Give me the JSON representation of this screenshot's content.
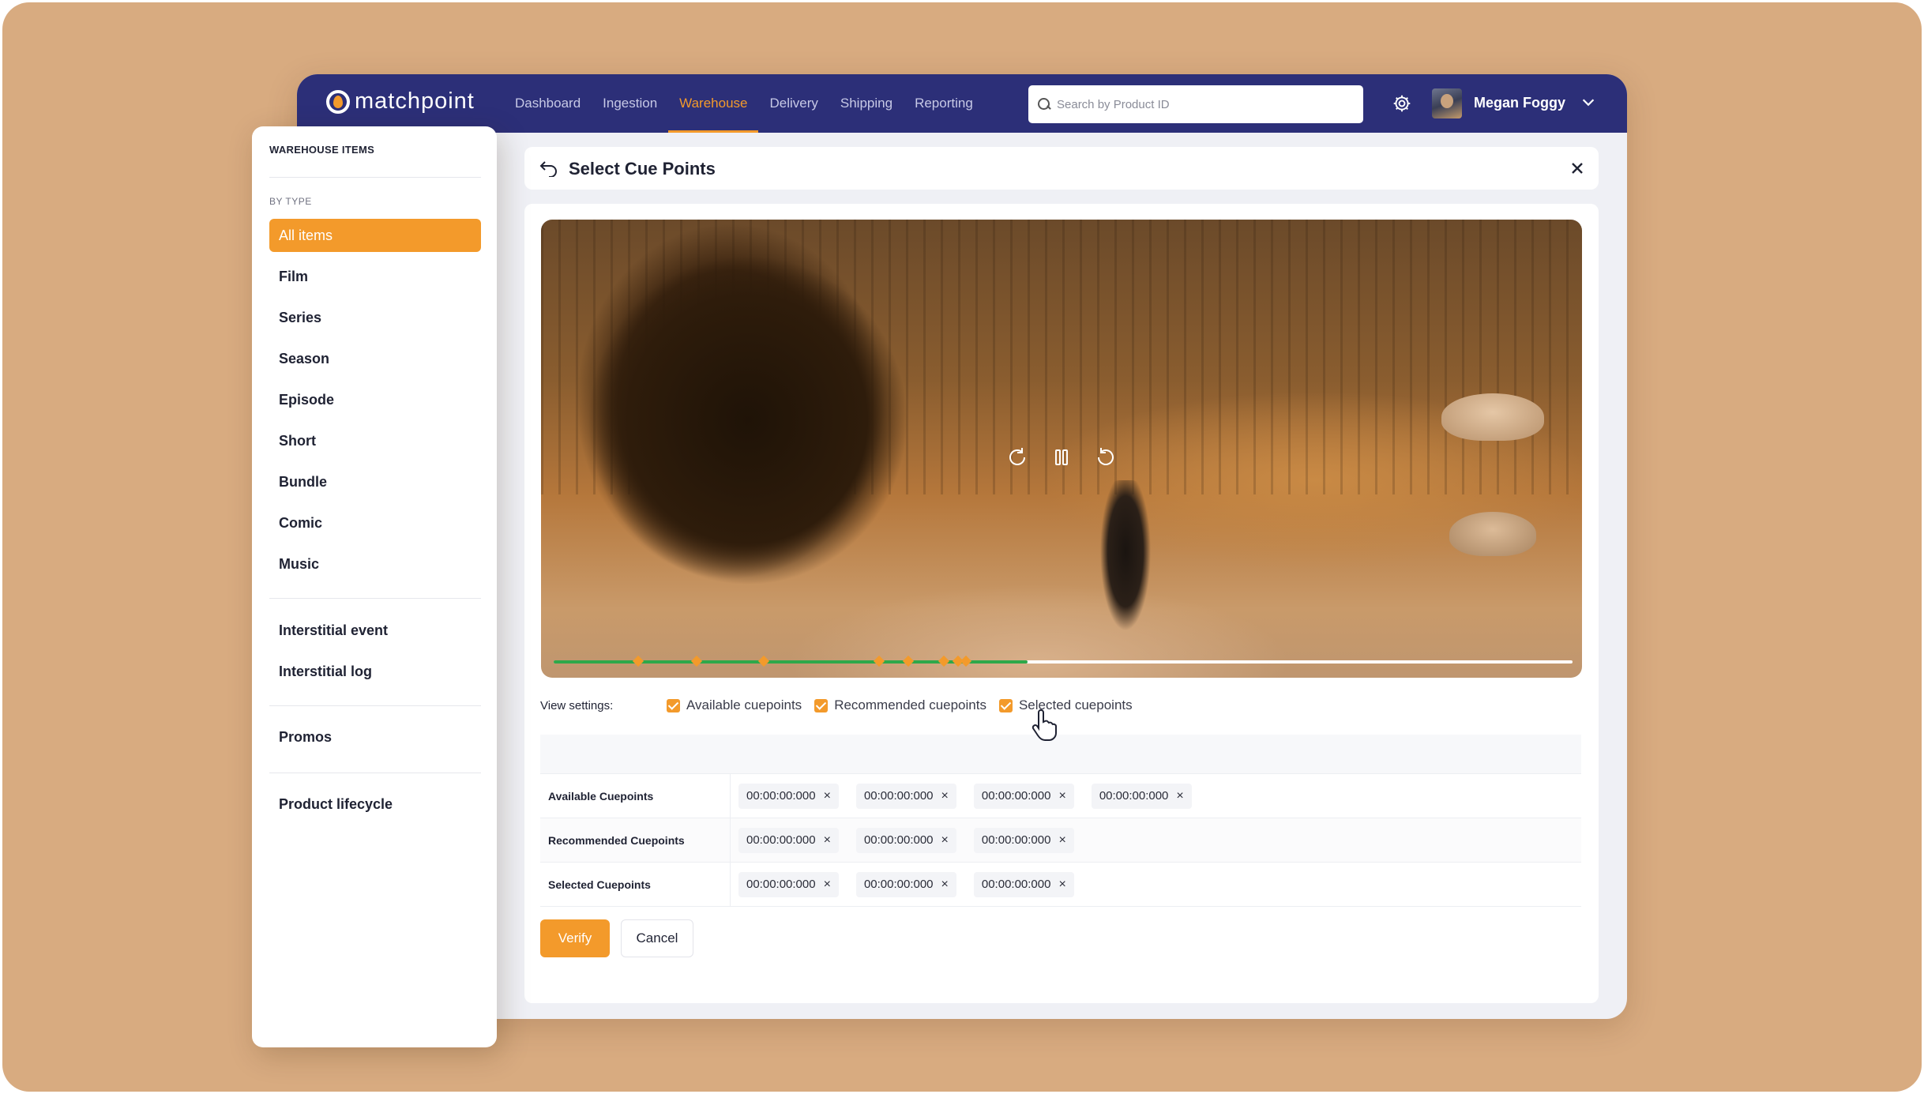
{
  "app": {
    "logo_text": "matchpoint",
    "nav": [
      {
        "label": "Dashboard",
        "active": false
      },
      {
        "label": "Ingestion",
        "active": false
      },
      {
        "label": "Warehouse",
        "active": true
      },
      {
        "label": "Delivery",
        "active": false
      },
      {
        "label": "Shipping",
        "active": false
      },
      {
        "label": "Reporting",
        "active": false
      }
    ],
    "search": {
      "placeholder": "Search by Product ID",
      "value": ""
    },
    "user": {
      "name": "Megan Foggy"
    },
    "accent_color": "#f39a2b",
    "header_color": "#2c2f78"
  },
  "sidebar": {
    "title": "WAREHOUSE  ITEMS",
    "section_label": "BY TYPE",
    "items": [
      {
        "label": "All items",
        "active": true
      },
      {
        "label": "Film"
      },
      {
        "label": "Series"
      },
      {
        "label": "Season"
      },
      {
        "label": "Episode"
      },
      {
        "label": "Short"
      },
      {
        "label": "Bundle"
      },
      {
        "label": "Comic"
      },
      {
        "label": "Music"
      },
      {
        "label": "Interstitial event"
      },
      {
        "label": "Interstitial log"
      },
      {
        "label": "Promos"
      },
      {
        "label": "Product lifecycle"
      }
    ]
  },
  "modal": {
    "title": "Select Cue Points",
    "player": {
      "progress_fraction": 0.465,
      "cue_markers": [
        0.083,
        0.14,
        0.206,
        0.319,
        0.348,
        0.383,
        0.397,
        0.405
      ],
      "controls": [
        "rewind-icon",
        "pause-icon",
        "forward-icon"
      ]
    },
    "view_settings": {
      "label": "View settings:",
      "options": [
        {
          "label": "Available cuepoints",
          "checked": true
        },
        {
          "label": "Recommended cuepoints",
          "checked": true
        },
        {
          "label": "Selected cuepoints",
          "checked": true
        }
      ]
    },
    "cuepoints": {
      "rows": [
        {
          "label": "Available Cuepoints",
          "chips": [
            "00:00:00:000",
            "00:00:00:000",
            "00:00:00:000",
            "00:00:00:000"
          ]
        },
        {
          "label": "Recommended Cuepoints",
          "chips": [
            "00:00:00:000",
            "00:00:00:000",
            "00:00:00:000"
          ]
        },
        {
          "label": "Selected Cuepoints",
          "chips": [
            "00:00:00:000",
            "00:00:00:000",
            "00:00:00:000"
          ]
        }
      ]
    },
    "verify_label": "Verify",
    "cancel_label": "Cancel"
  }
}
